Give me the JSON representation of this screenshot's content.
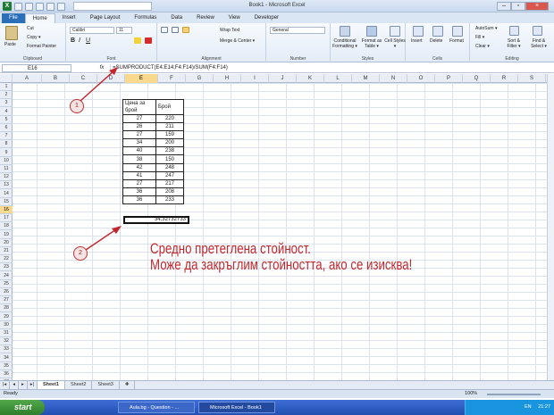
{
  "window": {
    "title": "Book1 - Microsoft Excel"
  },
  "ribbon_tabs": [
    "File",
    "Home",
    "Insert",
    "Page Layout",
    "Formulas",
    "Data",
    "Review",
    "View",
    "Developer"
  ],
  "ribbon": {
    "clipboard": {
      "label": "Clipboard",
      "paste": "Paste",
      "cut": "Cut",
      "copy": "Copy ▾",
      "format_painter": "Format Painter"
    },
    "font": {
      "label": "Font",
      "name": "Calibri",
      "size": "11",
      "bold": "B",
      "italic": "I",
      "underline": "U"
    },
    "alignment": {
      "label": "Alignment",
      "wrap": "Wrap Text",
      "merge": "Merge & Center ▾"
    },
    "number": {
      "label": "Number",
      "format": "General"
    },
    "styles": {
      "label": "Styles",
      "cond": "Conditional Formatting ▾",
      "table": "Format as Table ▾",
      "cell": "Cell Styles ▾"
    },
    "cells": {
      "label": "Cells",
      "insert": "Insert",
      "delete": "Delete",
      "format": "Format"
    },
    "editing": {
      "label": "Editing",
      "autosum": "AutoSum ▾",
      "fill": "Fill ▾",
      "clear": "Clear ▾",
      "sort": "Sort & Filter ▾",
      "find": "Find & Select ▾"
    }
  },
  "formula_bar": {
    "name_box": "E16",
    "fx": "fx",
    "formula": "=SUMPRODUCT(E4:E14;F4:F14)/SUM(F4:F14)"
  },
  "columns": [
    "A",
    "B",
    "C",
    "D",
    "E",
    "F",
    "G",
    "H",
    "I",
    "J",
    "K",
    "L",
    "M",
    "N",
    "O",
    "P",
    "Q",
    "R",
    "S"
  ],
  "active_column": "E",
  "rows": [
    1,
    2,
    3,
    4,
    5,
    6,
    7,
    8,
    9,
    10,
    11,
    12,
    13,
    14,
    15,
    16,
    17,
    18,
    19,
    20,
    21,
    22,
    23,
    24,
    25,
    26,
    27,
    28,
    29,
    30,
    31,
    32,
    33,
    34,
    35,
    36,
    37
  ],
  "active_row": 16,
  "table": {
    "headers": [
      "Цена за брой",
      "Брой"
    ],
    "rows": [
      [
        "27",
        "220"
      ],
      [
        "26",
        "211"
      ],
      [
        "27",
        "159"
      ],
      [
        "34",
        "200"
      ],
      [
        "40",
        "238"
      ],
      [
        "38",
        "150"
      ],
      [
        "42",
        "248"
      ],
      [
        "41",
        "247"
      ],
      [
        "27",
        "217"
      ],
      [
        "36",
        "208"
      ],
      [
        "36",
        "233"
      ]
    ]
  },
  "result_cell": {
    "value": "34,32732733"
  },
  "annotations": {
    "callout1": "1",
    "callout2": "2",
    "line1": "Средно претеглена стойност.",
    "line2": "Може да закръглим стойността, ако се изисква!"
  },
  "sheet_tabs": [
    "Sheet1",
    "Sheet2",
    "Sheet3"
  ],
  "status": {
    "text": "Ready",
    "zoom": "100%"
  },
  "taskbar": {
    "start": "start",
    "tasks": [
      "Aula.bg - Question - ...",
      "Microsoft Excel - Book1"
    ],
    "lang": "EN",
    "time": "21:27"
  }
}
